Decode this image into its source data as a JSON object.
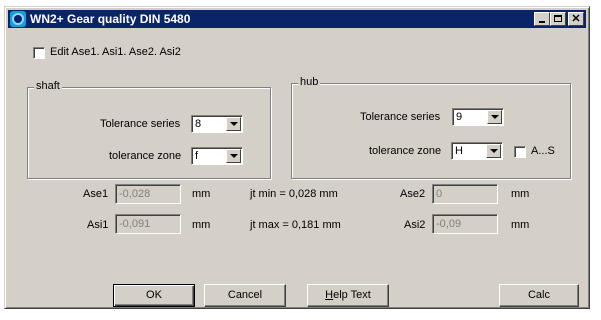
{
  "window": {
    "title": "WN2+ Gear quality DIN 5480"
  },
  "edit_checkbox": {
    "label": "Edit Ase1. Asi1. Ase2. Asi2"
  },
  "shaft": {
    "title": "shaft",
    "tolerance_series_label": "Tolerance series",
    "tolerance_series_value": "8",
    "tolerance_zone_label": "tolerance zone",
    "tolerance_zone_value": "f"
  },
  "hub": {
    "title": "hub",
    "tolerance_series_label": "Tolerance series",
    "tolerance_series_value": "9",
    "tolerance_zone_label": "tolerance zone",
    "tolerance_zone_value": "H",
    "as_checkbox_label": "A...S"
  },
  "results": {
    "ase1_label": "Ase1",
    "ase1_value": "-0,028",
    "ase1_unit": "mm",
    "asi1_label": "Asi1",
    "asi1_value": "-0,091",
    "asi1_unit": "mm",
    "jt_min": "jt min = 0,028 mm",
    "jt_max": "jt max = 0,181 mm",
    "ase2_label": "Ase2",
    "ase2_value": "0",
    "ase2_unit": "mm",
    "asi2_label": "Asi2",
    "asi2_value": "-0,09",
    "asi2_unit": "mm"
  },
  "buttons": {
    "ok": "OK",
    "cancel": "Cancel",
    "help_first": "H",
    "help_rest": "elp Text",
    "calc": "Calc"
  },
  "colors": {
    "titlebar": "#0a246a",
    "face": "#d4d0c8"
  }
}
